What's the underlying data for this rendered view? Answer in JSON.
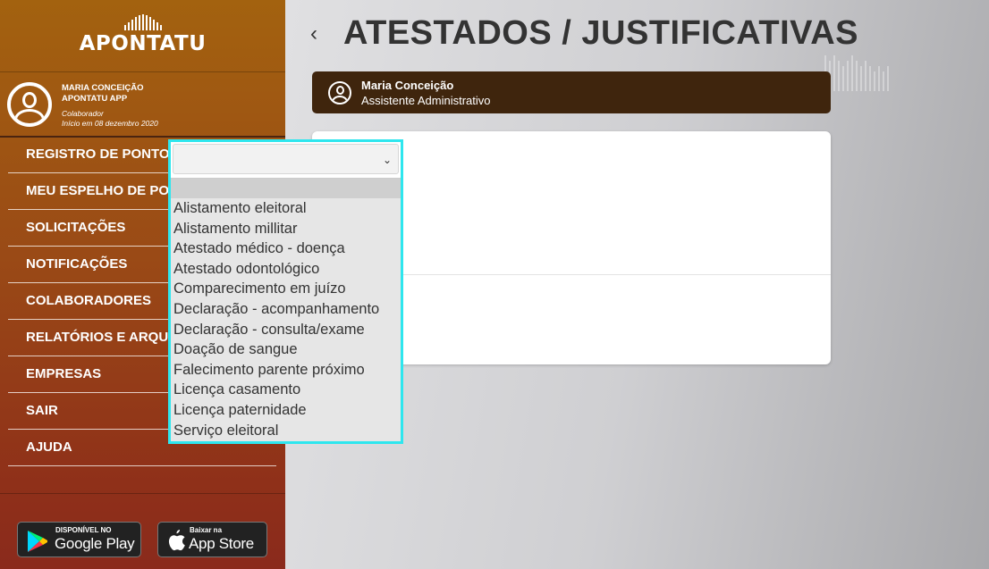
{
  "brand": {
    "logo_text": "APONTATU"
  },
  "profile": {
    "name_line1": "MARIA CONCEIçãO",
    "name_line2": "APONTATU APP",
    "role": "Colaborador",
    "since": "Início em 08 dezembro 2020"
  },
  "menu": [
    {
      "label": "REGISTRO DE PONTO"
    },
    {
      "label": "MEU ESPELHO DE PONTO"
    },
    {
      "label": "SOLICITAÇÕES"
    },
    {
      "label": "NOTIFICAÇÕES"
    },
    {
      "label": "COLABORADORES"
    },
    {
      "label": "RELATÓRIOS E ARQUIVOS"
    },
    {
      "label": "EMPRESAS"
    },
    {
      "label": "SAIR"
    },
    {
      "label": "AJUDA"
    }
  ],
  "stores": {
    "google": {
      "small": "DISPONÍVEL NO",
      "big": "Google Play"
    },
    "apple": {
      "small": "Baixar na",
      "big": "App Store"
    }
  },
  "page": {
    "back_glyph": "‹",
    "title": "ATESTADOS / JUSTIFICATIVAS"
  },
  "employee": {
    "name": "Maria Conceição",
    "role": "Assistente Administrativo"
  },
  "select": {
    "value": "",
    "chevron": "⌄",
    "options": [
      "",
      "Alistamento eleitoral",
      "Alistamento millitar",
      "Atestado médico - doença",
      "Atestado odontológico",
      "Comparecimento em juízo",
      "Declaração - acompanhamento",
      "Declaração - consulta/exame",
      "Doação de sangue",
      "Falecimento parente próximo",
      "Licença casamento",
      "Licença paternidade",
      "Serviço eleitoral"
    ]
  },
  "colors": {
    "sidebar_top": "#a3620f",
    "sidebar_bottom": "#8a2a1c",
    "employee_bar": "#3f250d",
    "focus_ring": "#2ee6ee"
  }
}
